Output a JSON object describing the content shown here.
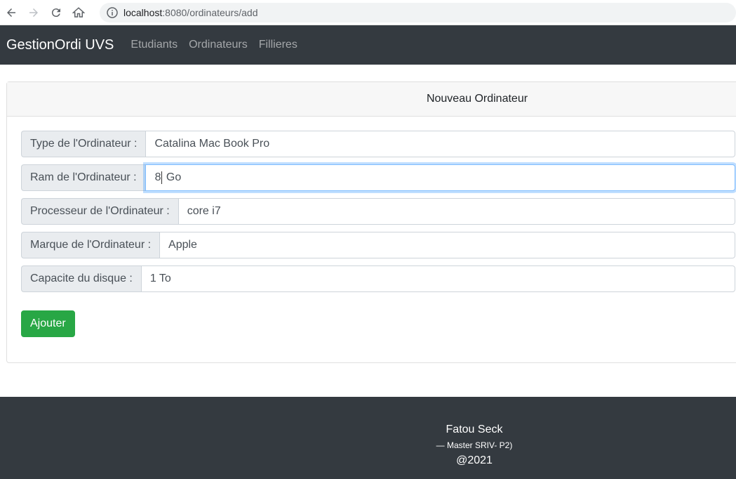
{
  "browser": {
    "url_host": "localhost",
    "url_path": ":8080/ordinateurs/add"
  },
  "navbar": {
    "brand": "GestionOrdi UVS",
    "links": [
      "Etudiants",
      "Ordinateurs",
      "Fillieres"
    ]
  },
  "form": {
    "title": "Nouveau Ordinateur",
    "fields": [
      {
        "label": "Type de l'Ordinateur :",
        "value": "Catalina Mac Book Pro"
      },
      {
        "label": "Ram de l'Ordinateur :",
        "value_before_caret": "8",
        "value_after_caret": " Go"
      },
      {
        "label": "Processeur de l'Ordinateur :",
        "value": "core i7"
      },
      {
        "label": "Marque de l'Ordinateur :",
        "value": "Apple"
      },
      {
        "label": "Capacite du disque :",
        "value": "1 To"
      }
    ],
    "submit_label": "Ajouter"
  },
  "footer": {
    "name": "Fatou Seck",
    "subtitle": "—  Master SRIV- P2)",
    "year": "@2021"
  },
  "colors": {
    "navbar_bg": "#343a40",
    "success": "#28a745",
    "focus_border": "#80bdff"
  }
}
